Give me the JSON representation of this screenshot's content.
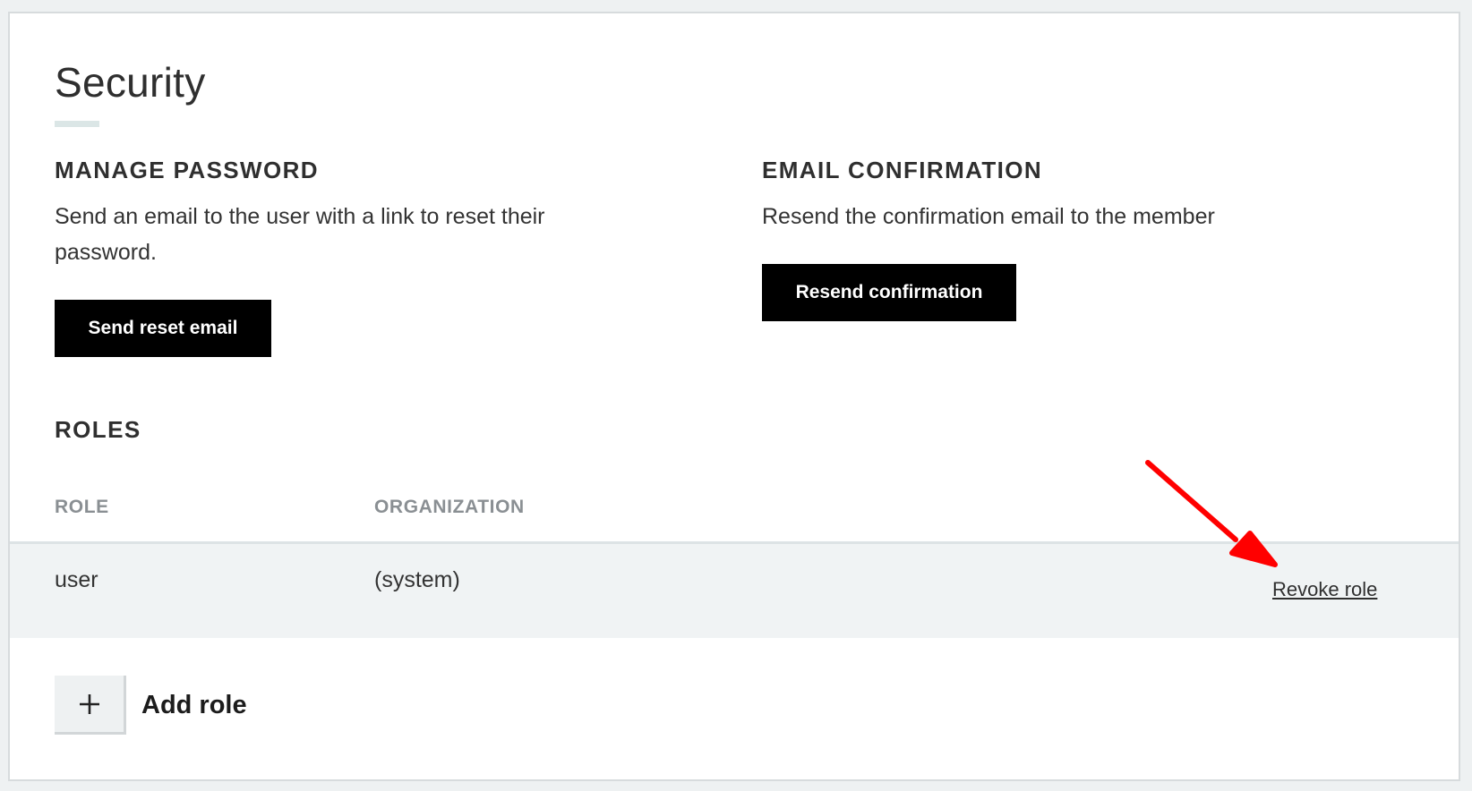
{
  "page": {
    "title": "Security"
  },
  "manage_password": {
    "heading": "MANAGE PASSWORD",
    "description": "Send an email to the user with a link to reset their password.",
    "button_label": "Send reset email"
  },
  "email_confirmation": {
    "heading": "EMAIL CONFIRMATION",
    "description": "Resend the confirmation email to the member",
    "button_label": "Resend confirmation"
  },
  "roles": {
    "heading": "ROLES",
    "columns": {
      "role": "ROLE",
      "organization": "ORGANIZATION"
    },
    "rows": [
      {
        "role": "user",
        "organization": "(system)",
        "action_label": "Revoke role"
      }
    ],
    "add_label": "Add role"
  },
  "colors": {
    "button_background": "#000000",
    "button_text": "#ffffff",
    "row_highlight": "#f0f3f4",
    "annotation_arrow": "#ff0000"
  },
  "icons": {
    "add": "plus-icon",
    "annotation": "red-arrow-annotation"
  }
}
